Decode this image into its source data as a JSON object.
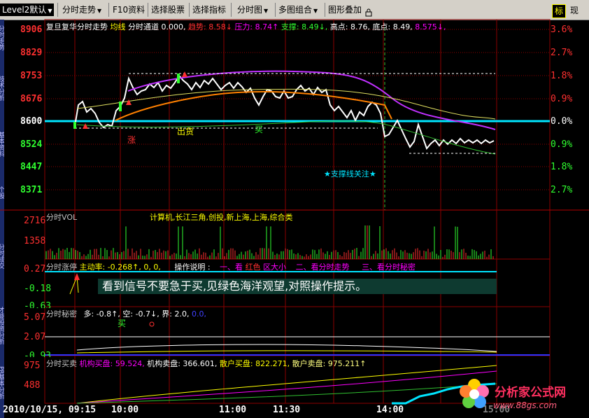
{
  "toolbar": {
    "level2": "Level2默认",
    "intraday_trend": "分时走势",
    "f10": "F10资料",
    "select_stock": "选择股票",
    "select_indicator": "选择指标",
    "intraday_chart": "分时图",
    "multi_combo": "多图组合",
    "graph_overlay": "图形叠加",
    "tab_biao": "标",
    "tab_xian": "现"
  },
  "left_strip": {
    "labels": [
      "分时走势",
      "技术分析",
      "基本资料",
      "个股",
      "分时成交",
      "才能投资分析",
      "PB基本分析"
    ]
  },
  "main": {
    "header": {
      "stock": "复旦复华分时走势",
      "avg_line": "均线",
      "channel": "分时通道",
      "channel_val": "0.000,",
      "trend_label": "趋势:",
      "trend_val": "8.58↓",
      "pressure_label": "压力:",
      "pressure_val": "8.74↑",
      "support_label": "支撑:",
      "support_val": "8.49↓,",
      "high_label": "高点:",
      "high_val": "8.76,",
      "low_label": "底点:",
      "low_val": "8.49,",
      "extra_val": "8.575↓,"
    },
    "price_labels": [
      "8906",
      "8829",
      "8753",
      "8676",
      "8600",
      "8524",
      "8447",
      "8371"
    ],
    "pct_labels": [
      "3.6%",
      "2.7%",
      "1.8%",
      "0.9%",
      "0.0%",
      "0.9%",
      "1.8%",
      "2.7%"
    ],
    "annot_chuhuo": "出货",
    "annot_mai_mid": "买",
    "annot_zhang": "涨",
    "annot_support": "★支撑线关注★",
    "colors": {
      "up": "#ff3030",
      "down": "#30ff30",
      "grid": "#8b0000",
      "baseline": "#00e5ff"
    }
  },
  "vol": {
    "title": "分时VOL",
    "sectors": "计算机,长江三角,创投,新上海,上海,综合类",
    "labels": [
      "2716",
      "1358"
    ]
  },
  "limit_panel": {
    "title": "分时涨停",
    "active_rate": "主动率: -0.268↑, 0, 0,",
    "op_label": "操作说明 :",
    "item1_a": "一、看",
    "item1_b": "红色",
    "item1_c": "区大小",
    "item2": "二、看分时走势",
    "item3": "三、看分时秘密",
    "labels": [
      "0.27",
      "-0.18",
      "-0.63"
    ],
    "note": "看到信号不要急于买,见绿色海洋观望,对照操作提示。"
  },
  "secret_panel": {
    "title": "分时秘密",
    "duo": "多: -0.8↑,",
    "kong": "空: -0.7↓,",
    "jie": "界: 2.0,",
    "jie2": "0.0,",
    "buy": "买",
    "labels": [
      "5.07",
      "2.07",
      "-0.93"
    ]
  },
  "trade_panel": {
    "title": "分时买卖",
    "inst_buy": "机构买盘: 59.524,",
    "inst_sell": "机构卖盘: 366.601,",
    "retail_buy": "散户买盘: 822.271,",
    "retail_sell": "散户卖盘: 975.211↑",
    "labels": [
      "975",
      "488"
    ]
  },
  "time_axis": {
    "start": "2010/10/15, 09:15",
    "t1": "10:00",
    "t2": "11:00",
    "t3": "11:30",
    "t4": "14:00",
    "t5": "15:00"
  },
  "watermark": {
    "name": "分析家公式网",
    "url": "www.88gs.com"
  }
}
